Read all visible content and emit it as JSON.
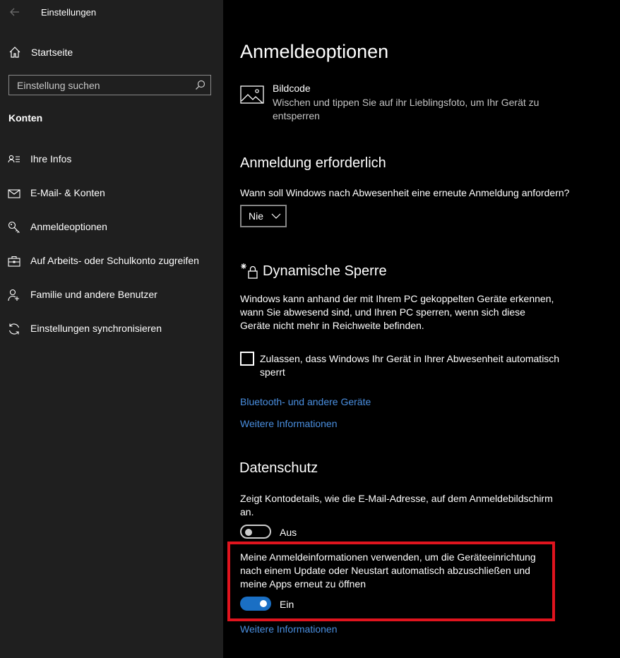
{
  "window": {
    "title": "Einstellungen"
  },
  "sidebar": {
    "home_label": "Startseite",
    "search_placeholder": "Einstellung suchen",
    "section_title": "Konten",
    "items": [
      {
        "label": "Ihre Infos",
        "icon": "contact-card-icon"
      },
      {
        "label": "E-Mail- & Konten",
        "icon": "mail-icon"
      },
      {
        "label": "Anmeldeoptionen",
        "icon": "key-icon"
      },
      {
        "label": "Auf Arbeits- oder Schulkonto zugreifen",
        "icon": "briefcase-icon"
      },
      {
        "label": "Familie und andere Benutzer",
        "icon": "add-person-icon"
      },
      {
        "label": "Einstellungen synchronisieren",
        "icon": "sync-icon"
      }
    ]
  },
  "main": {
    "title": "Anmeldeoptionen",
    "picture_password": {
      "title": "Bildcode",
      "description": "Wischen und tippen Sie auf ihr Lieblingsfoto, um Ihr Gerät zu entsperren"
    },
    "require_signin": {
      "heading": "Anmeldung erforderlich",
      "question": "Wann soll Windows nach Abwesenheit eine erneute Anmeldung anfordern?",
      "dropdown_value": "Nie"
    },
    "dynamic_lock": {
      "heading": "Dynamische Sperre",
      "description": "Windows kann anhand der mit Ihrem PC gekoppelten Geräte erkennen, wann Sie abwesend sind, und Ihren PC sperren, wenn sich diese Geräte nicht mehr in Reichweite befinden.",
      "checkbox_label": "Zulassen, dass Windows Ihr Gerät in Ihrer Abwesenheit automatisch sperrt",
      "checkbox_checked": false,
      "link_bluetooth": "Bluetooth- und andere Geräte",
      "link_more": "Weitere Informationen"
    },
    "privacy": {
      "heading": "Datenschutz",
      "account_details_text": "Zeigt Kontodetails, wie die E-Mail-Adresse, auf dem Anmeldebildschirm an.",
      "account_details_state": "Aus",
      "signin_info_text": "Meine Anmeldeinformationen verwenden, um die Geräteeinrichtung nach einem Update oder Neustart automatisch abzuschließen und meine Apps erneut zu öffnen",
      "signin_info_state": "Ein",
      "link_more": "Weitere Informationen"
    }
  },
  "colors": {
    "sidebar_bg": "#1f1f1f",
    "main_bg": "#000000",
    "accent": "#1a6fc4",
    "link": "#4a8fe0",
    "highlight": "#e0141e"
  }
}
